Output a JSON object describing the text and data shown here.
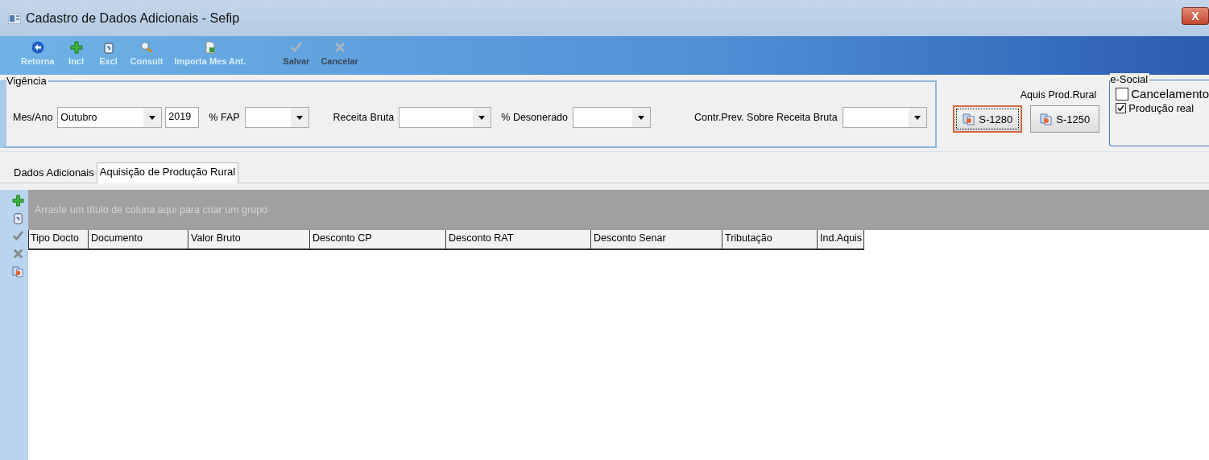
{
  "window": {
    "title": "Cadastro de Dados Adicionais - Sefip",
    "close": "X"
  },
  "toolbar": [
    {
      "label": "Retorna",
      "kind": "back",
      "disabled": false
    },
    {
      "label": "Incl",
      "kind": "plus",
      "disabled": false
    },
    {
      "label": "Excl",
      "kind": "bin",
      "disabled": false
    },
    {
      "label": "Consult",
      "kind": "search",
      "disabled": false
    },
    {
      "label": "Importa Mes Ant.",
      "kind": "doc",
      "disabled": false
    },
    {
      "label": "Salvar",
      "kind": "check",
      "disabled": true
    },
    {
      "label": "Cancelar",
      "kind": "x",
      "disabled": true
    }
  ],
  "vigencia": {
    "title": "Vigência",
    "mes_ano_label": "Mes/Ano",
    "mes": "Outubro",
    "ano": "2019",
    "fap_label": "% FAP",
    "receita_label": "Receita Bruta",
    "desonerado_label": "% Desonerado",
    "contr_label": "Contr.Prev. Sobre Receita Bruta"
  },
  "aquis": {
    "label": "Aquis Prod.Rural",
    "buttons": [
      {
        "label": "S-1280",
        "focused": true
      },
      {
        "label": "S-1250",
        "focused": false
      }
    ]
  },
  "esocial": {
    "title": "e-Social",
    "options": [
      {
        "label": "Cancelamento",
        "checked": false
      },
      {
        "label": "Produção real",
        "checked": true
      }
    ]
  },
  "tabs": [
    {
      "label": "Dados Adicionais",
      "selected": false
    },
    {
      "label": "Aquisição de Produção Rural",
      "selected": true
    }
  ],
  "side_tools": [
    {
      "kind": "plus"
    },
    {
      "kind": "bin"
    },
    {
      "kind": "check"
    },
    {
      "kind": "x"
    },
    {
      "kind": "doc"
    }
  ],
  "grid": {
    "group_hint": "Arraste um título de coluna aqui para criar um grupo",
    "columns": [
      "Tipo Docto",
      "Documento",
      "Valor Bruto",
      "Desconto CP",
      "Desconto RAT",
      "Desconto Senar",
      "Tributação",
      "Ind.Aquis"
    ]
  }
}
